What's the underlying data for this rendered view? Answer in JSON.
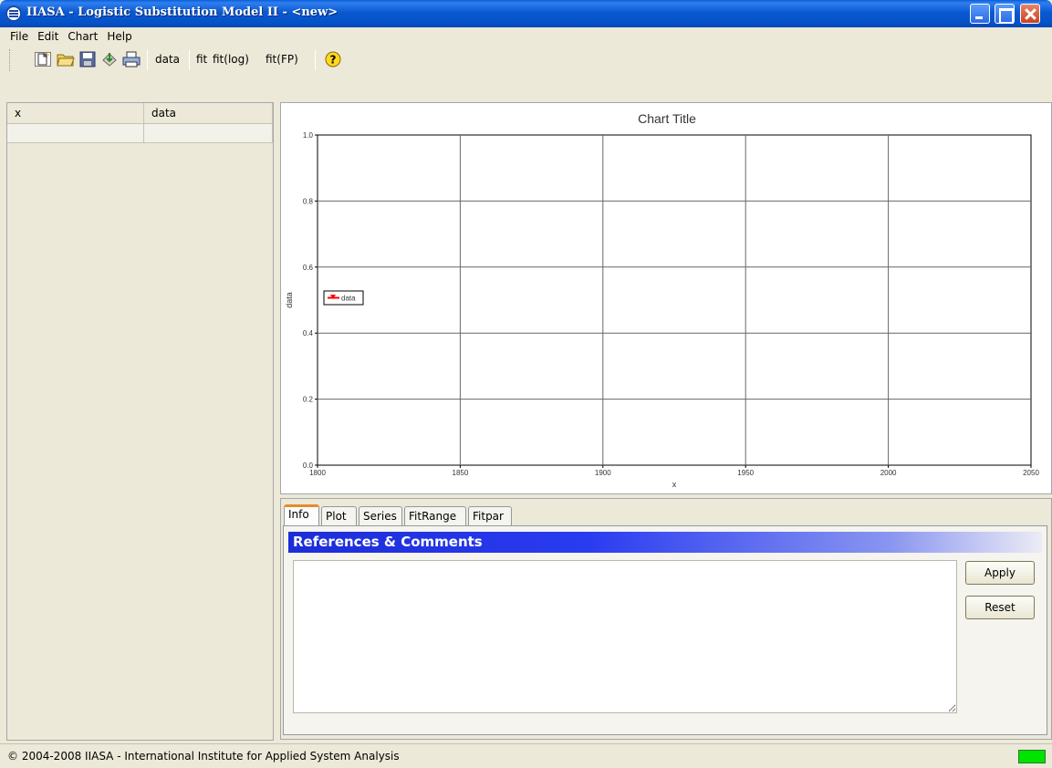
{
  "window": {
    "title": "IIASA - Logistic Substitution Model II - <new>"
  },
  "menu": [
    "File",
    "Edit",
    "Chart",
    "Help"
  ],
  "toolbar": {
    "icons": [
      "new-icon",
      "open-folder-icon",
      "save-icon",
      "export-icon",
      "print-icon"
    ],
    "data_label": "data",
    "fit_label": "fit",
    "fitlog_label": "fit(log)",
    "fitfp_label": "fit(FP)",
    "help_icon": "help-icon"
  },
  "table": {
    "columns": [
      "x",
      "data"
    ]
  },
  "chart_data": {
    "type": "line",
    "title": "Chart Title",
    "xlabel": "x",
    "ylabel": "data",
    "xlim": [
      1800,
      2050
    ],
    "ylim": [
      0.0,
      1.0
    ],
    "x_ticks": [
      "1800",
      "1850",
      "1900",
      "1950",
      "2000",
      "2050"
    ],
    "y_ticks": [
      "0.0",
      "0.2",
      "0.4",
      "0.6",
      "0.8",
      "1.0"
    ],
    "grid": true,
    "legend": "left",
    "series": [
      {
        "name": "data",
        "color": "#ff0000",
        "x": [],
        "y": []
      }
    ]
  },
  "tabs": [
    "Info",
    "Plot",
    "Series",
    "FitRange",
    "Fitpar"
  ],
  "info": {
    "header": "References & Comments",
    "comments_value": "",
    "apply_label": "Apply",
    "reset_label": "Reset"
  },
  "status": {
    "text": "© 2004-2008  IIASA - International Institute for Applied System Analysis",
    "indicator_color": "#00e400"
  }
}
